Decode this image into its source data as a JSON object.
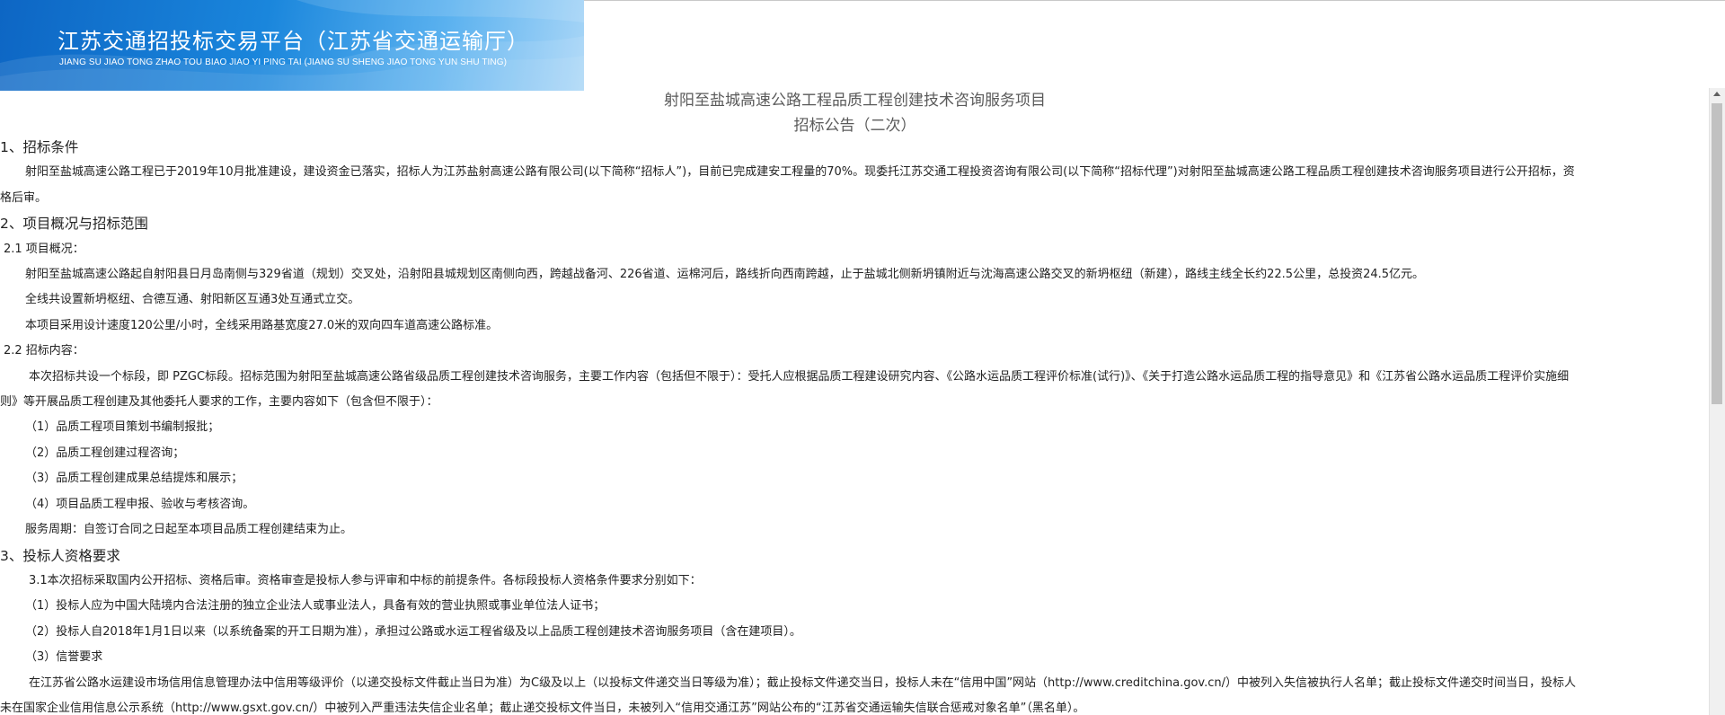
{
  "banner": {
    "title_cn": "江苏交通招投标交易平台（江苏省交通运输厅）",
    "title_en": "JIANG SU JIAO TONG ZHAO TOU BIAO JIAO YI PING TAI  (JIANG SU SHENG JIAO TONG YUN SHU TING)"
  },
  "heading": {
    "project": "射阳至盐城高速公路工程品质工程创建技术咨询服务项目",
    "notice": "招标公告（二次）"
  },
  "lines": [
    {
      "text": "1、招标条件",
      "section": true,
      "indent": 0
    },
    {
      "text": "射阳至盐城高速公路工程已于2019年10月批准建设，建设资金已落实，招标人为江苏盐射高速公路有限公司(以下简称“招标人”)，目前已完成建安工程量的70%。现委托江苏交通工程投资咨询有限公司(以下简称“招标代理”)对射阳至盐城高速公路工程品质工程创建技术咨询服务项目进行公开招标，资",
      "section": false,
      "indent": 28
    },
    {
      "text": "格后审。",
      "section": false,
      "indent": 0
    },
    {
      "text": "2、项目概况与招标范围",
      "section": true,
      "indent": 0
    },
    {
      "text": "2.1    项目概况：",
      "section": false,
      "indent": 4
    },
    {
      "text": "射阳至盐城高速公路起自射阳县日月岛南侧与329省道（规划）交叉处，沿射阳县城规划区南侧向西，跨越战备河、226省道、运棉河后，路线折向西南跨越，止于盐城北侧新坍镇附近与沈海高速公路交叉的新坍枢纽（新建），路线主线全长约22.5公里，总投资24.5亿元。",
      "section": false,
      "indent": 28
    },
    {
      "text": "全线共设置新坍枢纽、合德互通、射阳新区互通3处互通式立交。",
      "section": false,
      "indent": 28
    },
    {
      "text": "本项目采用设计速度120公里/小时，全线采用路基宽度27.0米的双向四车道高速公路标准。",
      "section": false,
      "indent": 28
    },
    {
      "text": "2.2    招标内容：",
      "section": false,
      "indent": 4
    },
    {
      "text": "本次招标共设一个标段，即 PZGC标段。招标范围为射阳至盐城高速公路省级品质工程创建技术咨询服务，主要工作内容（包括但不限于）：受托人应根据品质工程建设研究内容、《公路水运品质工程评价标准(试行)》、《关于打造公路水运品质工程的指导意见》和《江苏省公路水运品质工程评价实施细",
      "section": false,
      "indent": 32
    },
    {
      "text": "则》等开展品质工程创建及其他委托人要求的工作，主要内容如下（包含但不限于）：",
      "section": false,
      "indent": 0
    },
    {
      "text": "（1）品质工程项目策划书编制报批；",
      "section": false,
      "indent": 28
    },
    {
      "text": "（2）品质工程创建过程咨询；",
      "section": false,
      "indent": 28
    },
    {
      "text": "（3）品质工程创建成果总结提炼和展示；",
      "section": false,
      "indent": 28
    },
    {
      "text": "（4）项目品质工程申报、验收与考核咨询。",
      "section": false,
      "indent": 28
    },
    {
      "text": "服务周期：自签订合同之日起至本项目品质工程创建结束为止。",
      "section": false,
      "indent": 28
    },
    {
      "text": "3、投标人资格要求",
      "section": true,
      "indent": 0
    },
    {
      "text": "3.1本次招标采取国内公开招标、资格后审。资格审查是投标人参与评审和中标的前提条件。各标段投标人资格条件要求分别如下：",
      "section": false,
      "indent": 32
    },
    {
      "text": "（1）投标人应为中国大陆境内合法注册的独立企业法人或事业法人，具备有效的营业执照或事业单位法人证书；",
      "section": false,
      "indent": 28
    },
    {
      "text": "（2）投标人自2018年1月1日以来（以系统备案的开工日期为准），承担过公路或水运工程省级及以上品质工程创建技术咨询服务项目（含在建项目）。",
      "section": false,
      "indent": 28
    },
    {
      "text": "（3）信誉要求",
      "section": false,
      "indent": 28
    },
    {
      "text": "在江苏省公路水运建设市场信用信息管理办法中信用等级评价（以递交投标文件截止当日为准）为C级及以上（以投标文件递交当日等级为准）；截止投标文件递交当日，投标人未在“信用中国”网站（http://www.creditchina.gov.cn/）中被列入失信被执行人名单；截止投标文件递交时间当日，投标人",
      "section": false,
      "indent": 32
    },
    {
      "text": "未在国家企业信用信息公示系统（http://www.gsxt.gov.cn/）中被列入严重违法失信企业名单；截止递交投标文件当日，未被列入“信用交通江苏”网站公布的“江苏省交通运输失信联合惩戒对象名单”（黑名单）。",
      "section": false,
      "indent": 0
    }
  ]
}
